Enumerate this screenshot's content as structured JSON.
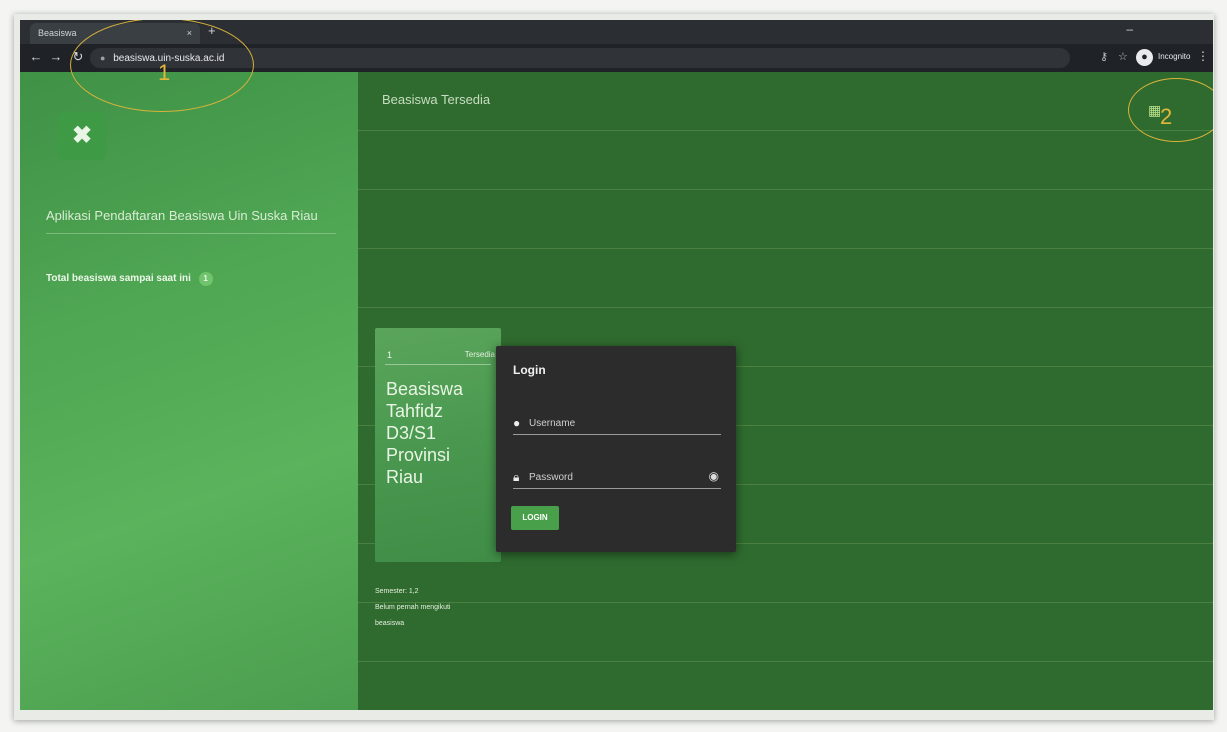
{
  "browser": {
    "tab_title": "Beasiswa",
    "url": "beasiswa.uin-suska.ac.id",
    "profile_label": "Incognito"
  },
  "sidebar": {
    "app_title": "Aplikasi Pendaftaran Beasiswa Uin Suska Riau",
    "total_label": "Total beasiswa sampai saat ini",
    "total_count": "1"
  },
  "main": {
    "title": "Beasiswa Tersedia"
  },
  "card": {
    "number": "1",
    "status": "Tersedia",
    "name_lines": [
      "Beasiswa",
      "Tahfidz",
      "D3/S1",
      "Provinsi",
      "Riau"
    ],
    "meta": [
      "Semester: 1,2",
      "Belum pernah mengikuti",
      "beasiswa"
    ]
  },
  "login": {
    "title": "Login",
    "username_placeholder": "Username",
    "password_placeholder": "Password",
    "button_label": "LOGIN"
  },
  "annotations": {
    "marker_1": "1",
    "marker_2": "2",
    "color": "#d9b23a"
  },
  "colors": {
    "page_bg": "#2f6b2f",
    "sidebar_bg": "#4fa653",
    "modal_bg": "#2c2c2c",
    "button_green": "#49a04a"
  },
  "icons": {
    "logo": "x-logo-icon",
    "username": "user-circle-icon",
    "password": "lock-icon",
    "toggle_password": "eye-slash-icon",
    "header": "grid-menu-icon"
  }
}
